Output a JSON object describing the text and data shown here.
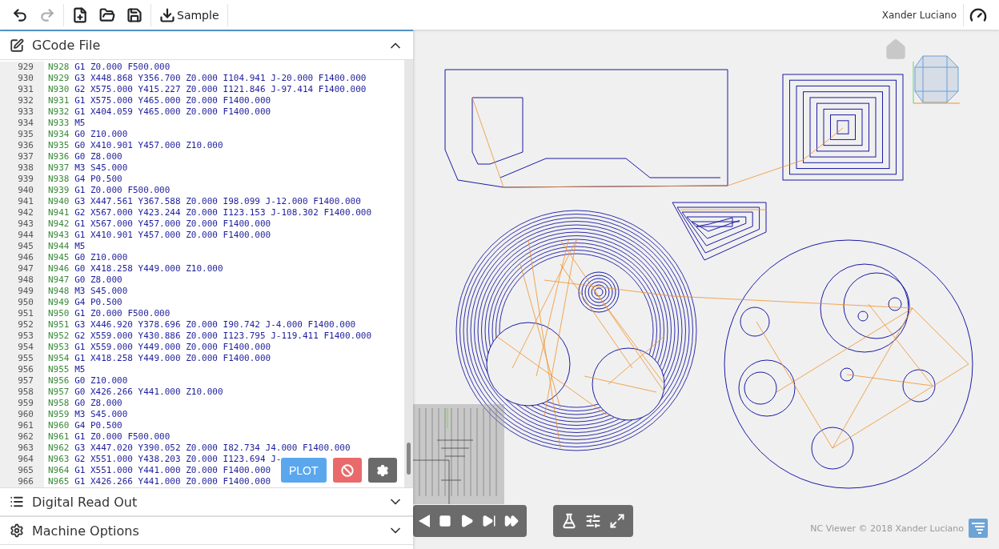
{
  "toolbar": {
    "buttons": [
      {
        "kind": "undo",
        "disabled": false
      },
      {
        "kind": "redo",
        "disabled": true
      },
      {
        "kind": "separator"
      },
      {
        "kind": "new",
        "disabled": false
      },
      {
        "kind": "open",
        "disabled": false
      },
      {
        "kind": "save",
        "disabled": false
      },
      {
        "kind": "separator"
      },
      {
        "kind": "download",
        "disabled": false,
        "label": "Sample"
      },
      {
        "kind": "separator"
      }
    ],
    "user": "Xander Luciano"
  },
  "panels": [
    {
      "kind": "edit",
      "title": "GCode File",
      "expanded": true
    },
    {
      "kind": "list",
      "title": "Digital Read Out",
      "expanded": false
    },
    {
      "kind": "gear",
      "title": "Machine Options",
      "expanded": false
    }
  ],
  "editor": {
    "lines": [
      {
        "number": "929",
        "code": "N928 G1 Z0.000 F500.000"
      },
      {
        "number": "930",
        "code": "N929 G3 X448.868 Y356.700 Z0.000 I104.941 J-20.000 F1400.000"
      },
      {
        "number": "931",
        "code": "N930 G2 X575.000 Y415.227 Z0.000 I121.846 J-97.414 F1400.000"
      },
      {
        "number": "932",
        "code": "N931 G1 X575.000 Y465.000 Z0.000 F1400.000"
      },
      {
        "number": "933",
        "code": "N932 G1 X404.059 Y465.000 Z0.000 F1400.000"
      },
      {
        "number": "934",
        "code": "N933 M5"
      },
      {
        "number": "935",
        "code": "N934 G0 Z10.000"
      },
      {
        "number": "936",
        "code": "N935 G0 X410.901 Y457.000 Z10.000"
      },
      {
        "number": "937",
        "code": "N936 G0 Z8.000"
      },
      {
        "number": "938",
        "code": "N937 M3 S45.000"
      },
      {
        "number": "939",
        "code": "N938 G4 P0.500"
      },
      {
        "number": "940",
        "code": "N939 G1 Z0.000 F500.000"
      },
      {
        "number": "941",
        "code": "N940 G3 X447.561 Y367.588 Z0.000 I98.099 J-12.000 F1400.000"
      },
      {
        "number": "942",
        "code": "N941 G2 X567.000 Y423.244 Z0.000 I123.153 J-108.302 F1400.000"
      },
      {
        "number": "943",
        "code": "N942 G1 X567.000 Y457.000 Z0.000 F1400.000"
      },
      {
        "number": "944",
        "code": "N943 G1 X410.901 Y457.000 Z0.000 F1400.000"
      },
      {
        "number": "945",
        "code": "N944 M5"
      },
      {
        "number": "946",
        "code": "N945 G0 Z10.000"
      },
      {
        "number": "947",
        "code": "N946 G0 X418.258 Y449.000 Z10.000"
      },
      {
        "number": "948",
        "code": "N947 G0 Z8.000"
      },
      {
        "number": "949",
        "code": "N948 M3 S45.000"
      },
      {
        "number": "950",
        "code": "N949 G4 P0.500"
      },
      {
        "number": "951",
        "code": "N950 G1 Z0.000 F500.000"
      },
      {
        "number": "952",
        "code": "N951 G3 X446.920 Y378.696 Z0.000 I90.742 J-4.000 F1400.000"
      },
      {
        "number": "953",
        "code": "N952 G2 X559.000 Y430.886 Z0.000 I123.795 J-119.411 F1400.000"
      },
      {
        "number": "954",
        "code": "N953 G1 X559.000 Y449.000 Z0.000 F1400.000"
      },
      {
        "number": "955",
        "code": "N954 G1 X418.258 Y449.000 Z0.000 F1400.000"
      },
      {
        "number": "956",
        "code": "N955 M5"
      },
      {
        "number": "957",
        "code": "N956 G0 Z10.000"
      },
      {
        "number": "958",
        "code": "N957 G0 X426.266 Y441.000 Z10.000"
      },
      {
        "number": "959",
        "code": "N958 G0 Z8.000"
      },
      {
        "number": "960",
        "code": "N959 M3 S45.000"
      },
      {
        "number": "961",
        "code": "N960 G4 P0.500"
      },
      {
        "number": "962",
        "code": "N961 G1 Z0.000 F500.000"
      },
      {
        "number": "963",
        "code": "N962 G3 X447.020 Y390.052 Z0.000 I82.734 J4.000 F1400.000"
      },
      {
        "number": "964",
        "code": "N963 G2 X551.000 Y438.203 Z0.000 I123.694 J-"
      },
      {
        "number": "965",
        "code": "N964 G1 X551.000 Y441.000 Z0.000 F1400.000"
      },
      {
        "number": "966",
        "code": "N965 G1 X426.266 Y441.000 Z0.000 F1400.000"
      }
    ],
    "buttons": [
      {
        "kind": "plot",
        "label": "PLOT"
      },
      {
        "kind": "cancel"
      },
      {
        "kind": "settings"
      }
    ]
  },
  "playback": [
    {
      "kind": "back"
    },
    {
      "kind": "stop"
    },
    {
      "kind": "play"
    },
    {
      "kind": "step"
    },
    {
      "kind": "end"
    }
  ],
  "view_tools": [
    {
      "kind": "flask"
    },
    {
      "kind": "sliders"
    },
    {
      "kind": "expand"
    }
  ],
  "footer": "NC Viewer © 2018 Xander Luciano"
}
